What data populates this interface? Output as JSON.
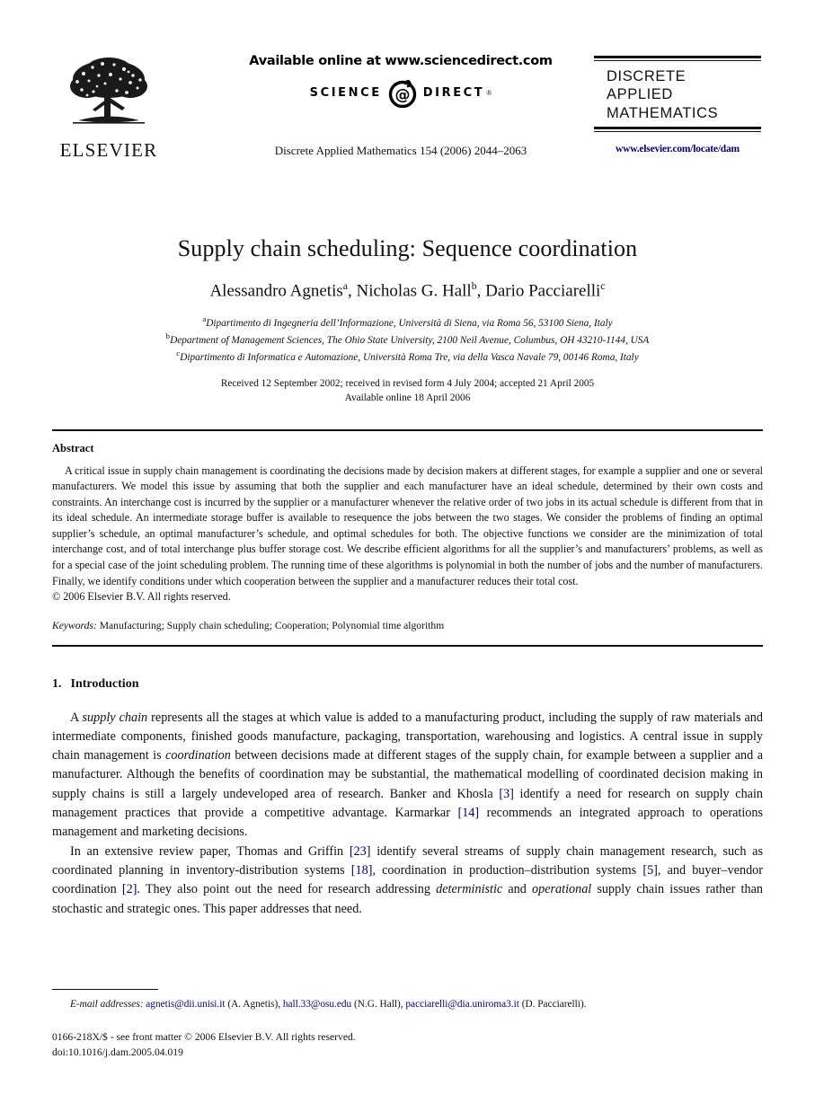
{
  "header": {
    "publisher_logo_text": "ELSEVIER",
    "available_online": "Available online at www.sciencedirect.com",
    "sciencedirect_left": "SCIENCE",
    "sciencedirect_right": "DIRECT",
    "sciencedirect_sup": "®",
    "journal_reference": "Discrete Applied Mathematics 154 (2006) 2044–2063",
    "journal_logo_line1": "DISCRETE",
    "journal_logo_line2": "APPLIED",
    "journal_logo_line3": "MATHEMATICS",
    "journal_url": "www.elsevier.com/locate/dam",
    "link_color": "#000080"
  },
  "title": "Supply chain scheduling: Sequence coordination",
  "authors": [
    {
      "name": "Alessandro Agnetis",
      "marker": "a",
      "sep": ", "
    },
    {
      "name": "Nicholas G. Hall",
      "marker": "b",
      "sep": ", "
    },
    {
      "name": "Dario Pacciarelli",
      "marker": "c",
      "sep": ""
    }
  ],
  "affiliations": [
    {
      "marker": "a",
      "text": "Dipartimento di Ingegneria dell’Informazione, Università di Siena, via Roma 56, 53100 Siena, Italy"
    },
    {
      "marker": "b",
      "text": "Department of Management Sciences, The Ohio State University, 2100 Neil Avenue, Columbus, OH 43210-1144, USA"
    },
    {
      "marker": "c",
      "text": "Dipartimento di Informatica e Automazione, Università Roma Tre, via della Vasca Navale 79, 00146 Roma, Italy"
    }
  ],
  "dates": {
    "received": "Received 12 September 2002; received in revised form 4 July 2004; accepted 21 April 2005",
    "available_online": "Available online 18 April 2006"
  },
  "abstract": {
    "heading": "Abstract",
    "text": "A critical issue in supply chain management is coordinating the decisions made by decision makers at different stages, for example a supplier and one or several manufacturers. We model this issue by assuming that both the supplier and each manufacturer have an ideal schedule, determined by their own costs and constraints. An interchange cost is incurred by the supplier or a manufacturer whenever the relative order of two jobs in its actual schedule is different from that in its ideal schedule. An intermediate storage buffer is available to resequence the jobs between the two stages. We consider the problems of finding an optimal supplier’s schedule, an optimal manufacturer’s schedule, and optimal schedules for both. The objective functions we consider are the minimization of total interchange cost, and of total interchange plus buffer storage cost. We describe efficient algorithms for all the supplier’s and manufacturers’ problems, as well as for a special case of the joint scheduling problem. The running time of these algorithms is polynomial in both the number of jobs and the number of manufacturers. Finally, we identify conditions under which cooperation between the supplier and a manufacturer reduces their total cost.",
    "copyright": "© 2006 Elsevier B.V. All rights reserved."
  },
  "keywords": {
    "label": "Keywords:",
    "value": " Manufacturing; Supply chain scheduling; Cooperation; Polynomial time algorithm"
  },
  "introduction": {
    "number": "1.",
    "heading": "Introduction",
    "paragraph1_parts": [
      {
        "t": "A  ",
        "style": "normal"
      },
      {
        "t": "supply chain",
        "style": "italic"
      },
      {
        "t": " represents all the stages at which value is added to a manufacturing product, including the supply of raw materials and intermediate components, finished goods manufacture, packaging, transportation, warehousing and logistics. A central issue in supply chain management is ",
        "style": "normal"
      },
      {
        "t": "coordination",
        "style": "italic"
      },
      {
        "t": " between decisions made at different stages of the supply chain, for example between a supplier and a manufacturer. Although the benefits of coordination may be substantial, the mathematical modelling of coordinated decision making in supply chains is still a largely undeveloped area of research. Banker and Khosla ",
        "style": "normal"
      },
      {
        "t": "[3]",
        "style": "ref"
      },
      {
        "t": " identify a need for research on supply chain management practices that provide a competitive advantage. Karmarkar ",
        "style": "normal"
      },
      {
        "t": "[14]",
        "style": "ref"
      },
      {
        "t": " recommends an integrated approach to operations management and marketing decisions.",
        "style": "normal"
      }
    ],
    "paragraph2_parts": [
      {
        "t": "In an extensive review paper, Thomas and Griffin ",
        "style": "normal"
      },
      {
        "t": "[23]",
        "style": "ref"
      },
      {
        "t": " identify several streams of supply chain management research, such as coordinated planning in inventory-distribution systems ",
        "style": "normal"
      },
      {
        "t": "[18]",
        "style": "ref"
      },
      {
        "t": ", coordination in production–distribution systems ",
        "style": "normal"
      },
      {
        "t": "[5]",
        "style": "ref"
      },
      {
        "t": ", and buyer–vendor coordination ",
        "style": "normal"
      },
      {
        "t": "[2]",
        "style": "ref"
      },
      {
        "t": ". They also point out the need for research addressing ",
        "style": "normal"
      },
      {
        "t": "deterministic",
        "style": "italic"
      },
      {
        "t": " and ",
        "style": "normal"
      },
      {
        "t": "operational",
        "style": "italic"
      },
      {
        "t": " supply chain issues rather than stochastic and strategic ones. This paper addresses that need.",
        "style": "normal"
      }
    ]
  },
  "footnote": {
    "label": "E-mail addresses:",
    "entries": [
      {
        "email": "agnetis@dii.unisi.it",
        "person": " (A. Agnetis), "
      },
      {
        "email": "hall.33@osu.edu",
        "person": " (N.G. Hall), "
      },
      {
        "email": "pacciarelli@dia.uniroma3.it",
        "person": " (D. Pacciarelli)."
      }
    ]
  },
  "imprint": {
    "issn_line": "0166-218X/$ - see front matter © 2006 Elsevier B.V. All rights reserved.",
    "doi_line": "doi:10.1016/j.dam.2005.04.019"
  }
}
